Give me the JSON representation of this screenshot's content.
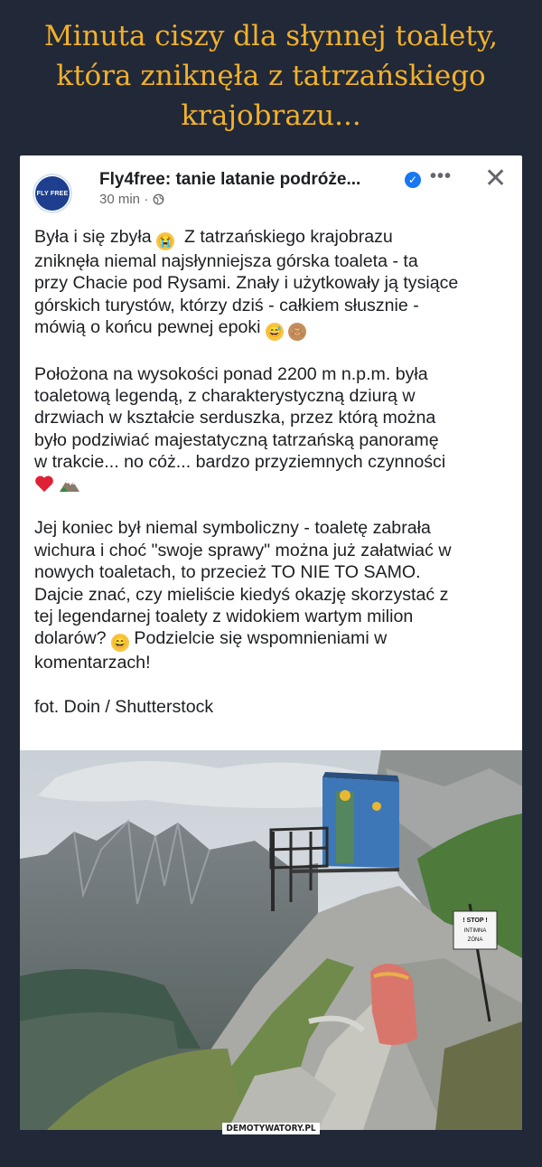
{
  "headline": {
    "line1": "Minuta ciszy dla słynnej toalety,",
    "line2": "która zniknęła z tatrzańskiego",
    "line3": "krajobrazu..."
  },
  "post": {
    "page_name": "Fly4free: tanie latanie podróże...",
    "avatar_text": "FLY FREE",
    "time": "30 min ·",
    "privacy_icon": "globe-icon",
    "more_icon": "more-dots-icon",
    "close_icon": "close-icon",
    "paragraphs": {
      "p1_l1": "Była i się zbyła",
      "p1_l1b": "Z tatrzańskiego krajobrazu",
      "p1_l2": "zniknęła niemal najsłynniejsza górska toaleta - ta",
      "p1_l3": "przy Chacie pod Rysami. Znały i użytkowały ją tysiące",
      "p1_l4": "górskich turystów, którzy dziś - całkiem słusznie -",
      "p1_l5": "mówią o końcu pewnej epoki",
      "p2_l1": "Położona na wysokości ponad 2200 m n.p.m. była",
      "p2_l2": "toaletową legendą, z charakterystyczną dziurą w",
      "p2_l3": "drzwiach w kształcie serduszka, przez którą można",
      "p2_l4": "było podziwiać majestatyczną tatrzańską panoramę",
      "p2_l5": "w trakcie... no cóż... bardzo przyziemnych czynności",
      "p3_l1": "Jej koniec był niemal symboliczny - toaletę zabrała",
      "p3_l2": "wichura i choć \"swoje sprawy\" można już załatwiać w",
      "p3_l3": "nowych toaletach, to przecież TO NIE TO SAMO.",
      "p3_l4": "Dajcie znać, czy mieliście kiedyś okazję skorzystać z",
      "p3_l5": "tej legendarnej toalety z widokiem wartym milion",
      "p3_l6a": "dolarów?",
      "p3_l6b": "Podzielcie się wspomnieniami w",
      "p3_l7": "komentarzach!",
      "credit": "fot. Doin / Shutterstock"
    }
  },
  "photo": {
    "sign_line1": "! STOP !",
    "sign_line2": "INTIMNA",
    "sign_line3": "ZÓNA"
  },
  "watermark": "DEMOTYWATORY.PL",
  "colors": {
    "background": "#212838",
    "headline": "#f2b12a",
    "verified": "#1877f2"
  }
}
